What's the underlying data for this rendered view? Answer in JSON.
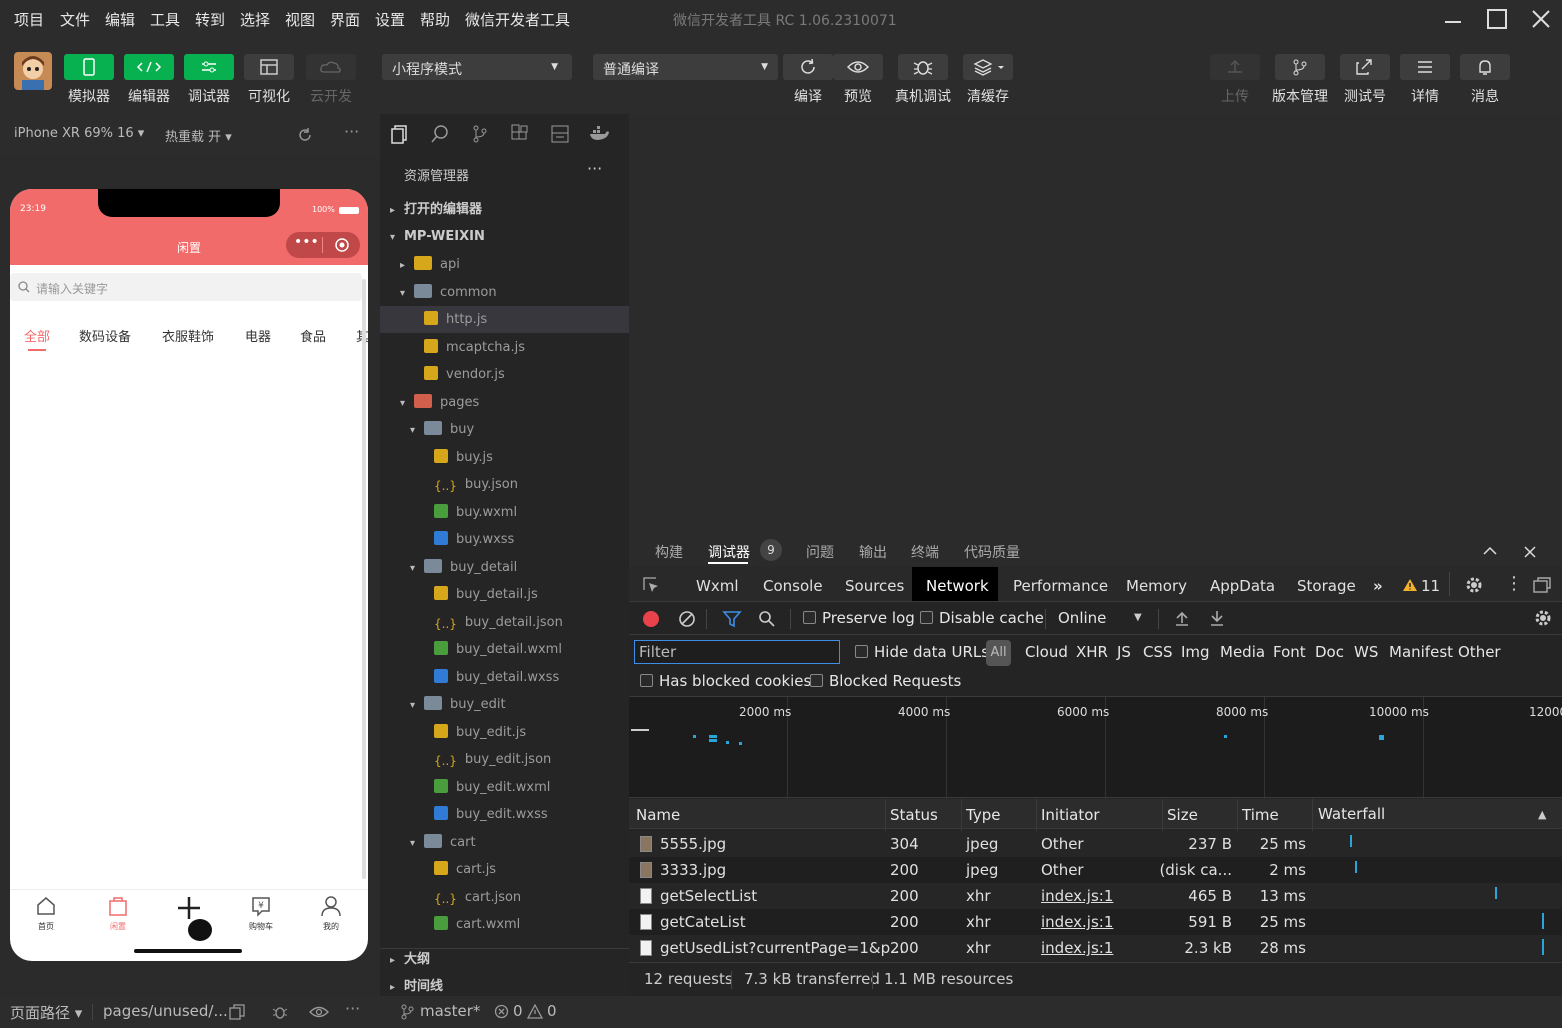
{
  "menu": [
    "项目",
    "文件",
    "编辑",
    "工具",
    "转到",
    "选择",
    "视图",
    "界面",
    "设置",
    "帮助",
    "微信开发者工具"
  ],
  "window_title": "微信开发者工具 RC 1.06.2310071",
  "toolbar": {
    "left": [
      "模拟器",
      "编辑器",
      "调试器",
      "可视化",
      "云开发"
    ],
    "mode": "小程序模式",
    "compile_mode": "普通编译",
    "mid": [
      "编译",
      "预览",
      "真机调试",
      "清缓存"
    ],
    "right": [
      "上传",
      "版本管理",
      "测试号",
      "详情",
      "消息"
    ]
  },
  "sim": {
    "device": "iPhone XR 69% 16 ▾",
    "hotreload": "热重载 开 ▾",
    "time": "23:19",
    "battery": "100%",
    "title": "闲置",
    "search_placeholder": "请输入关键字",
    "cats": [
      "全部",
      "数码设备",
      "衣服鞋饰",
      "电器",
      "食品",
      "其"
    ],
    "tabs": [
      "首页",
      "闲置",
      "",
      "购物车",
      "我的"
    ]
  },
  "explorer": {
    "title": "资源管理器",
    "open_editors": "打开的编辑器",
    "root": "MP-WEIXIN",
    "outline": "大纲",
    "timeline": "时间线",
    "items": [
      {
        "label": "api",
        "type": "foldery",
        "lvl": 1,
        "arrow": "▸"
      },
      {
        "label": "common",
        "type": "folder",
        "lvl": 1,
        "arrow": "▾"
      },
      {
        "label": "http.js",
        "type": "js",
        "lvl": 2,
        "sel": true
      },
      {
        "label": "mcaptcha.js",
        "type": "js",
        "lvl": 2
      },
      {
        "label": "vendor.js",
        "type": "js",
        "lvl": 2
      },
      {
        "label": "pages",
        "type": "folderr",
        "lvl": 1,
        "arrow": "▾"
      },
      {
        "label": "buy",
        "type": "folder",
        "lvl": 2,
        "arrow": "▾"
      },
      {
        "label": "buy.js",
        "type": "js",
        "lvl": 3
      },
      {
        "label": "buy.json",
        "type": "json",
        "lvl": 3
      },
      {
        "label": "buy.wxml",
        "type": "wxml",
        "lvl": 3
      },
      {
        "label": "buy.wxss",
        "type": "wxss",
        "lvl": 3
      },
      {
        "label": "buy_detail",
        "type": "folder",
        "lvl": 2,
        "arrow": "▾"
      },
      {
        "label": "buy_detail.js",
        "type": "js",
        "lvl": 3
      },
      {
        "label": "buy_detail.json",
        "type": "json",
        "lvl": 3
      },
      {
        "label": "buy_detail.wxml",
        "type": "wxml",
        "lvl": 3
      },
      {
        "label": "buy_detail.wxss",
        "type": "wxss",
        "lvl": 3
      },
      {
        "label": "buy_edit",
        "type": "folder",
        "lvl": 2,
        "arrow": "▾"
      },
      {
        "label": "buy_edit.js",
        "type": "js",
        "lvl": 3
      },
      {
        "label": "buy_edit.json",
        "type": "json",
        "lvl": 3
      },
      {
        "label": "buy_edit.wxml",
        "type": "wxml",
        "lvl": 3
      },
      {
        "label": "buy_edit.wxss",
        "type": "wxss",
        "lvl": 3
      },
      {
        "label": "cart",
        "type": "folder",
        "lvl": 2,
        "arrow": "▾"
      },
      {
        "label": "cart.js",
        "type": "js",
        "lvl": 3
      },
      {
        "label": "cart.json",
        "type": "json",
        "lvl": 3
      },
      {
        "label": "cart.wxml",
        "type": "wxml",
        "lvl": 3
      }
    ]
  },
  "devtools": {
    "top_tabs": [
      "构建",
      "调试器",
      "问题",
      "输出",
      "终端",
      "代码质量"
    ],
    "badge": "9",
    "tabs": [
      "Wxml",
      "Console",
      "Sources",
      "Network",
      "Performance",
      "Memory",
      "AppData",
      "Storage"
    ],
    "warn_count": "11",
    "preserve_log": "Preserve log",
    "disable_cache": "Disable cache",
    "throttle": "Online",
    "filter_placeholder": "Filter",
    "hide_data_urls": "Hide data URLs",
    "types": [
      "All",
      "Cloud",
      "XHR",
      "JS",
      "CSS",
      "Img",
      "Media",
      "Font",
      "Doc",
      "WS",
      "Manifest",
      "Other"
    ],
    "blocked_cookies": "Has blocked cookies",
    "blocked_requests": "Blocked Requests",
    "ticks": [
      "2000 ms",
      "4000 ms",
      "6000 ms",
      "8000 ms",
      "10000 ms",
      "12000"
    ],
    "columns": [
      "Name",
      "Status",
      "Type",
      "Initiator",
      "Size",
      "Time",
      "Waterfall"
    ],
    "rows": [
      {
        "name": "5555.jpg",
        "status": "304",
        "type": "jpeg",
        "initiator": "Other",
        "size": "237 B",
        "time": "25 ms",
        "link": false
      },
      {
        "name": "3333.jpg",
        "status": "200",
        "type": "jpeg",
        "initiator": "Other",
        "size": "(disk ca...",
        "time": "2 ms",
        "link": false
      },
      {
        "name": "getSelectList",
        "status": "200",
        "type": "xhr",
        "initiator": "index.js:1",
        "size": "465 B",
        "time": "13 ms",
        "link": true
      },
      {
        "name": "getCateList",
        "status": "200",
        "type": "xhr",
        "initiator": "index.js:1",
        "size": "591 B",
        "time": "25 ms",
        "link": true
      },
      {
        "name": "getUsedList?currentPage=1&p...",
        "status": "200",
        "type": "xhr",
        "initiator": "index.js:1",
        "size": "2.3 kB",
        "time": "28 ms",
        "link": true
      }
    ],
    "summary": [
      "12 requests",
      "7.3 kB transferred",
      "1.1 MB resources"
    ]
  },
  "status": {
    "path_label": "页面路径 ▾",
    "path": "pages/unused/...",
    "branch": "master*",
    "errors": "0",
    "warnings": "0"
  }
}
